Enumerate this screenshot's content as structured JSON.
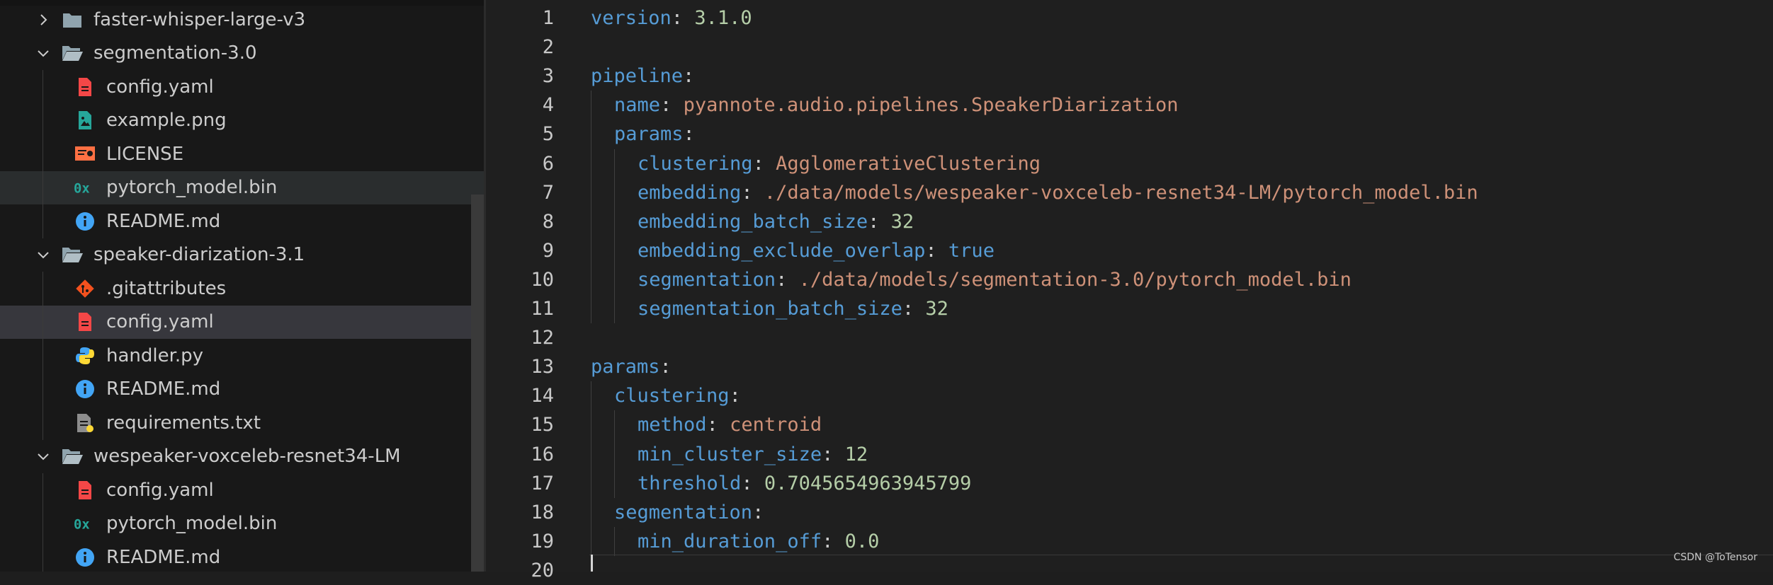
{
  "explorer": {
    "items": [
      {
        "label": "faster-whisper-large-v3",
        "kind": "folder",
        "expanded": false,
        "icon": "folder-icon"
      },
      {
        "label": "segmentation-3.0",
        "kind": "folder",
        "expanded": true,
        "icon": "folder-open-icon"
      },
      {
        "label": "config.yaml",
        "kind": "file",
        "icon": "yaml-file-icon"
      },
      {
        "label": "example.png",
        "kind": "file",
        "icon": "image-file-icon"
      },
      {
        "label": "LICENSE",
        "kind": "file",
        "icon": "license-file-icon"
      },
      {
        "label": "pytorch_model.bin",
        "kind": "file",
        "icon": "binary-file-icon"
      },
      {
        "label": "README.md",
        "kind": "file",
        "icon": "info-file-icon"
      },
      {
        "label": "speaker-diarization-3.1",
        "kind": "folder",
        "expanded": true,
        "icon": "folder-open-icon"
      },
      {
        "label": ".gitattributes",
        "kind": "file",
        "icon": "git-file-icon"
      },
      {
        "label": "config.yaml",
        "kind": "file",
        "icon": "yaml-file-icon"
      },
      {
        "label": "handler.py",
        "kind": "file",
        "icon": "python-file-icon"
      },
      {
        "label": "README.md",
        "kind": "file",
        "icon": "info-file-icon"
      },
      {
        "label": "requirements.txt",
        "kind": "file",
        "icon": "text-file-icon"
      },
      {
        "label": "wespeaker-voxceleb-resnet34-LM",
        "kind": "folder",
        "expanded": true,
        "icon": "folder-open-icon"
      },
      {
        "label": "config.yaml",
        "kind": "file",
        "icon": "yaml-file-icon"
      },
      {
        "label": "pytorch_model.bin",
        "kind": "file",
        "icon": "binary-file-icon"
      },
      {
        "label": "README.md",
        "kind": "file",
        "icon": "info-file-icon"
      }
    ]
  },
  "editor": {
    "lines": [
      {
        "n": "1",
        "key": "version",
        "value": "3.1.0",
        "vtype": "num"
      },
      {
        "n": "2"
      },
      {
        "n": "3",
        "key": "pipeline"
      },
      {
        "n": "4",
        "key": "name",
        "value": "pyannote.audio.pipelines.SpeakerDiarization",
        "vtype": "str"
      },
      {
        "n": "5",
        "key": "params"
      },
      {
        "n": "6",
        "key": "clustering",
        "value": "AgglomerativeClustering",
        "vtype": "str"
      },
      {
        "n": "7",
        "key": "embedding",
        "value": "./data/models/wespeaker-voxceleb-resnet34-LM/pytorch_model.bin",
        "vtype": "str"
      },
      {
        "n": "8",
        "key": "embedding_batch_size",
        "value": "32",
        "vtype": "num"
      },
      {
        "n": "9",
        "key": "embedding_exclude_overlap",
        "value": "true",
        "vtype": "bool"
      },
      {
        "n": "10",
        "key": "segmentation",
        "value": "./data/models/segmentation-3.0/pytorch_model.bin",
        "vtype": "str"
      },
      {
        "n": "11",
        "key": "segmentation_batch_size",
        "value": "32",
        "vtype": "num"
      },
      {
        "n": "12"
      },
      {
        "n": "13",
        "key": "params"
      },
      {
        "n": "14",
        "key": "clustering"
      },
      {
        "n": "15",
        "key": "method",
        "value": "centroid",
        "vtype": "str"
      },
      {
        "n": "16",
        "key": "min_cluster_size",
        "value": "12",
        "vtype": "num"
      },
      {
        "n": "17",
        "key": "threshold",
        "value": "0.7045654963945799",
        "vtype": "num"
      },
      {
        "n": "18",
        "key": "segmentation"
      },
      {
        "n": "19",
        "key": "min_duration_off",
        "value": "0.0",
        "vtype": "num"
      },
      {
        "n": "20"
      }
    ]
  },
  "watermark": "CSDN @ToTensor",
  "colors": {
    "key": "#569cd6",
    "string": "#ce9178",
    "number": "#b5cea8",
    "selected_row": "#37373d"
  }
}
